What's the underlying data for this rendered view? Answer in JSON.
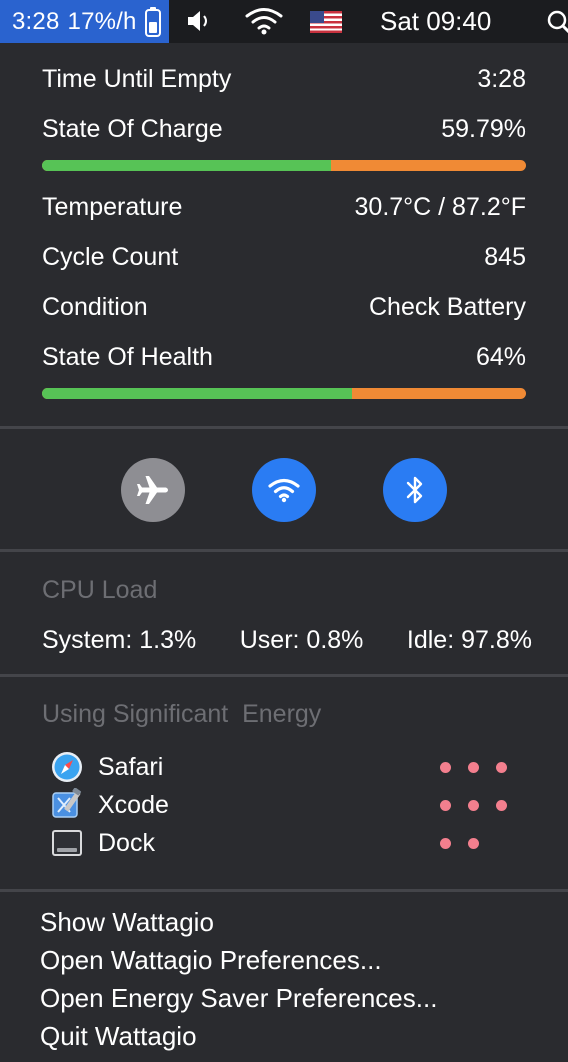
{
  "menubar": {
    "battery_time": "3:28",
    "battery_rate": "17%/h",
    "battery_icon": "battery-icon",
    "volume_icon": "speaker-icon",
    "wifi_icon": "wifi-icon",
    "flag_icon": "us-flag-icon",
    "datetime": "Sat 09:40",
    "search_icon": "magnifier-icon",
    "accent_color": "#2a63cf"
  },
  "battery": {
    "time_until_empty_label": "Time Until Empty",
    "time_until_empty_value": "3:28",
    "state_of_charge_label": "State Of Charge",
    "state_of_charge_value": "59.79%",
    "state_of_charge_fraction": 0.5979,
    "temperature_label": "Temperature",
    "temperature_value": "30.7°C / 87.2°F",
    "cycle_count_label": "Cycle Count",
    "cycle_count_value": "845",
    "condition_label": "Condition",
    "condition_value": "Check Battery",
    "state_of_health_label": "State Of Health",
    "state_of_health_value": "64%",
    "state_of_health_fraction": 0.64,
    "bar_fill_color": "#57c356",
    "bar_track_color": "#f08a35"
  },
  "toggles": [
    {
      "icon": "airplane-icon",
      "active": false,
      "color": "#8e8e93"
    },
    {
      "icon": "wifi-icon",
      "active": true,
      "color": "#2a7cf3"
    },
    {
      "icon": "bluetooth-icon",
      "active": true,
      "color": "#2a7cf3"
    }
  ],
  "cpu": {
    "title": "CPU Load",
    "system": "System: 1.3%",
    "user": "User: 0.8%",
    "idle": "Idle: 97.8%"
  },
  "energy": {
    "title": "Using Significant  Energy",
    "apps": [
      {
        "name": "Safari",
        "icon": "safari-icon",
        "dots": 3
      },
      {
        "name": "Xcode",
        "icon": "xcode-icon",
        "dots": 3
      },
      {
        "name": "Dock",
        "icon": "dock-icon",
        "dots": 2
      }
    ]
  },
  "menu": {
    "show": "Show Wattagio",
    "open_prefs": "Open Wattagio Preferences...",
    "open_energy": "Open Energy Saver Preferences...",
    "quit": "Quit Wattagio"
  }
}
